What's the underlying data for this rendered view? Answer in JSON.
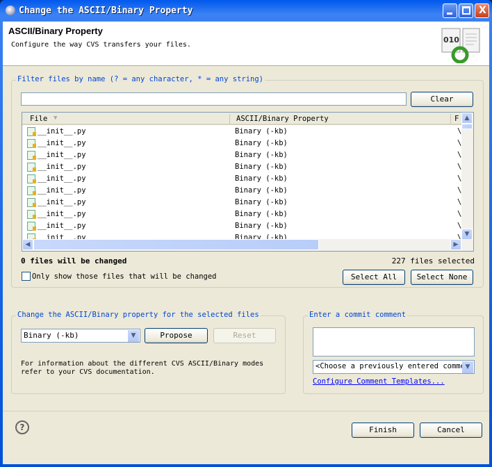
{
  "window": {
    "title": "Change the ASCII/Binary Property"
  },
  "header": {
    "title": "ASCII/Binary Property",
    "description": "Configure the way CVS transfers your files."
  },
  "filter": {
    "label": "Filter files by name (? = any character, * = any string)",
    "value": "",
    "clear_label": "Clear"
  },
  "table": {
    "columns": [
      "File",
      "ASCII/Binary Property",
      "F"
    ],
    "rows": [
      {
        "file": "__init__.py",
        "property": "Binary (-kb)",
        "extra": "\\"
      },
      {
        "file": "__init__.py",
        "property": "Binary (-kb)",
        "extra": "\\"
      },
      {
        "file": "__init__.py",
        "property": "Binary (-kb)",
        "extra": "\\"
      },
      {
        "file": "__init__.py",
        "property": "Binary (-kb)",
        "extra": "\\"
      },
      {
        "file": "__init__.py",
        "property": "Binary (-kb)",
        "extra": "\\"
      },
      {
        "file": "__init__.py",
        "property": "Binary (-kb)",
        "extra": "\\"
      },
      {
        "file": "__init__.py",
        "property": "Binary (-kb)",
        "extra": "\\"
      },
      {
        "file": "__init__.py",
        "property": "Binary (-kb)",
        "extra": "\\"
      },
      {
        "file": "__init__.py",
        "property": "Binary (-kb)",
        "extra": "\\"
      },
      {
        "file": "__init__.py",
        "property": "Binary (-kb)",
        "extra": "\\"
      }
    ]
  },
  "status": {
    "changed": "0 files will be changed",
    "selected": "227 files selected"
  },
  "only_show_label": "Only show those files that will be changed",
  "only_show_checked": false,
  "select_all_label": "Select All",
  "select_none_label": "Select None",
  "change_group": {
    "label": "Change the ASCII/Binary property for the selected files",
    "mode_value": "Binary (-kb)",
    "propose_label": "Propose",
    "reset_label": "Reset",
    "info": "For information about the different CVS ASCII/Binary modes refer to your CVS documentation."
  },
  "commit_group": {
    "label": "Enter a commit comment",
    "comment_value": "",
    "previous_placeholder": "<Choose a previously entered comment>",
    "configure_link": "Configure Comment Templates..."
  },
  "footer": {
    "finish_label": "Finish",
    "cancel_label": "Cancel"
  }
}
